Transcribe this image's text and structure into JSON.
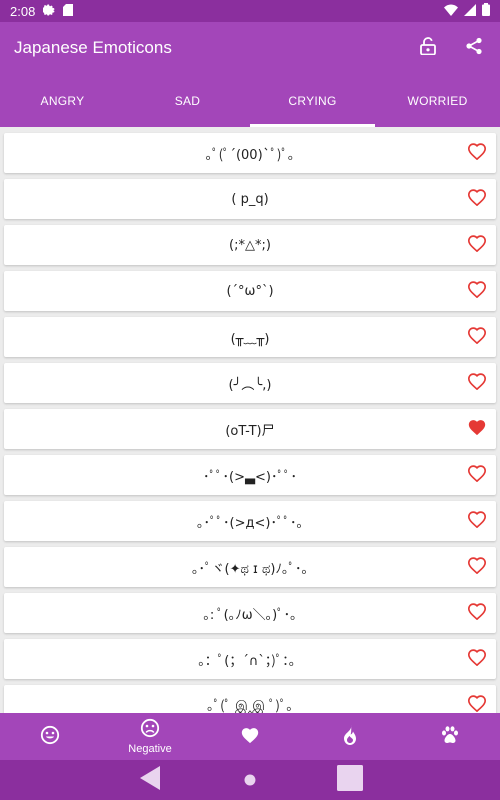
{
  "status_bar": {
    "time": "2:08"
  },
  "app_bar": {
    "title": "Japanese Emoticons"
  },
  "tabs": [
    {
      "label": "ANGRY",
      "active": false
    },
    {
      "label": "SAD",
      "active": false
    },
    {
      "label": "CRYING",
      "active": true
    },
    {
      "label": "WORRIED",
      "active": false
    }
  ],
  "emoticons": [
    {
      "text": "｡ﾟ(ﾟ´(00)`ﾟ)ﾟ｡",
      "favorite": false
    },
    {
      "text": "( p_q)",
      "favorite": false
    },
    {
      "text": "(;*△*;)",
      "favorite": false
    },
    {
      "text": "(´°ω°`)",
      "favorite": false
    },
    {
      "text": "(╥﹏╥)",
      "favorite": false
    },
    {
      "text": "(╯︵╰,)",
      "favorite": false
    },
    {
      "text": "(oT-T)尸",
      "favorite": true
    },
    {
      "text": "･ﾟﾟ･(>▃<)･ﾟﾟ･",
      "favorite": false
    },
    {
      "text": "｡･ﾟﾟ･(>д<)･ﾟﾟ･｡",
      "favorite": false
    },
    {
      "text": "｡･ﾟヾ(✦ಥ ɪ ಥ)ﾉ｡ﾟ･｡",
      "favorite": false
    },
    {
      "text": "｡: ﾟ(｡ﾉω＼｡)ﾟ･｡",
      "favorite": false
    },
    {
      "text": "。：ﾟ(；´∩`；)ﾟ：。",
      "favorite": false
    },
    {
      "text": "｡ﾟ(ﾟ இ‸இ ﾟ)ﾟ｡",
      "favorite": false
    }
  ],
  "bottom_nav": [
    {
      "icon": "smiley-icon",
      "label": ""
    },
    {
      "icon": "sad-face-icon",
      "label": "Negative"
    },
    {
      "icon": "heart-icon",
      "label": ""
    },
    {
      "icon": "fire-icon",
      "label": ""
    },
    {
      "icon": "paw-icon",
      "label": ""
    }
  ],
  "colors": {
    "primary": "#a346b9",
    "primary_dark": "#8b2f9e",
    "heart": "#e53935"
  }
}
